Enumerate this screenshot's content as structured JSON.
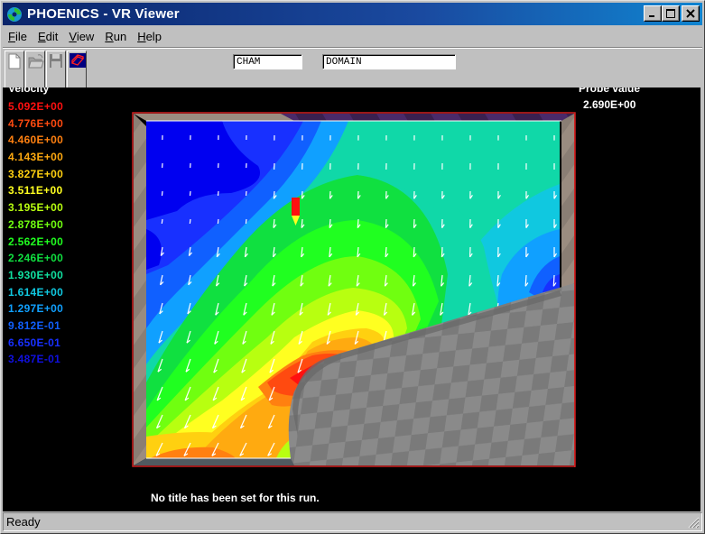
{
  "window": {
    "title": "PHOENICS - VR Viewer",
    "controls": {
      "minimize": "_",
      "maximize": "□",
      "close": "×"
    }
  },
  "menu": [
    {
      "label": "File",
      "accel": "F",
      "rest": "ile"
    },
    {
      "label": "Edit",
      "accel": "E",
      "rest": "dit"
    },
    {
      "label": "View",
      "accel": "V",
      "rest": "iew"
    },
    {
      "label": "Run",
      "accel": "R",
      "rest": "un"
    },
    {
      "label": "Help",
      "accel": "H",
      "rest": "elp"
    }
  ],
  "toolbar": {
    "buttons": [
      {
        "name": "new-file",
        "icon": "new-document-icon"
      },
      {
        "name": "open-file",
        "icon": "open-folder-icon"
      },
      {
        "name": "save-file",
        "icon": "floppy-disk-icon"
      },
      {
        "name": "vr-object",
        "icon": "red-wireframe-icon"
      }
    ],
    "field1": "CHAM",
    "field2": "DOMAIN"
  },
  "legend": {
    "title": "Velocity",
    "items": [
      {
        "value": "5.092E+00",
        "color": "#ff1010"
      },
      {
        "value": "4.776E+00",
        "color": "#ff4a10"
      },
      {
        "value": "4.460E+00",
        "color": "#ff8010"
      },
      {
        "value": "4.143E+00",
        "color": "#ffaa10"
      },
      {
        "value": "3.827E+00",
        "color": "#ffd010"
      },
      {
        "value": "3.511E+00",
        "color": "#ffff20"
      },
      {
        "value": "3.195E+00",
        "color": "#b8ff10"
      },
      {
        "value": "2.878E+00",
        "color": "#70ff10"
      },
      {
        "value": "2.562E+00",
        "color": "#20ff20"
      },
      {
        "value": "2.246E+00",
        "color": "#10e040"
      },
      {
        "value": "1.930E+00",
        "color": "#10e0a0"
      },
      {
        "value": "1.614E+00",
        "color": "#10c8e0"
      },
      {
        "value": "1.297E+00",
        "color": "#10a0ff"
      },
      {
        "value": "9.812E-01",
        "color": "#1060ff"
      },
      {
        "value": "6.650E-01",
        "color": "#1830ff"
      },
      {
        "value": "3.487E-01",
        "color": "#1010e0"
      }
    ]
  },
  "probe": {
    "label": "Probe value",
    "value": "2.690E+00"
  },
  "run_title": "No title has been set for this run.",
  "status": "Ready"
}
